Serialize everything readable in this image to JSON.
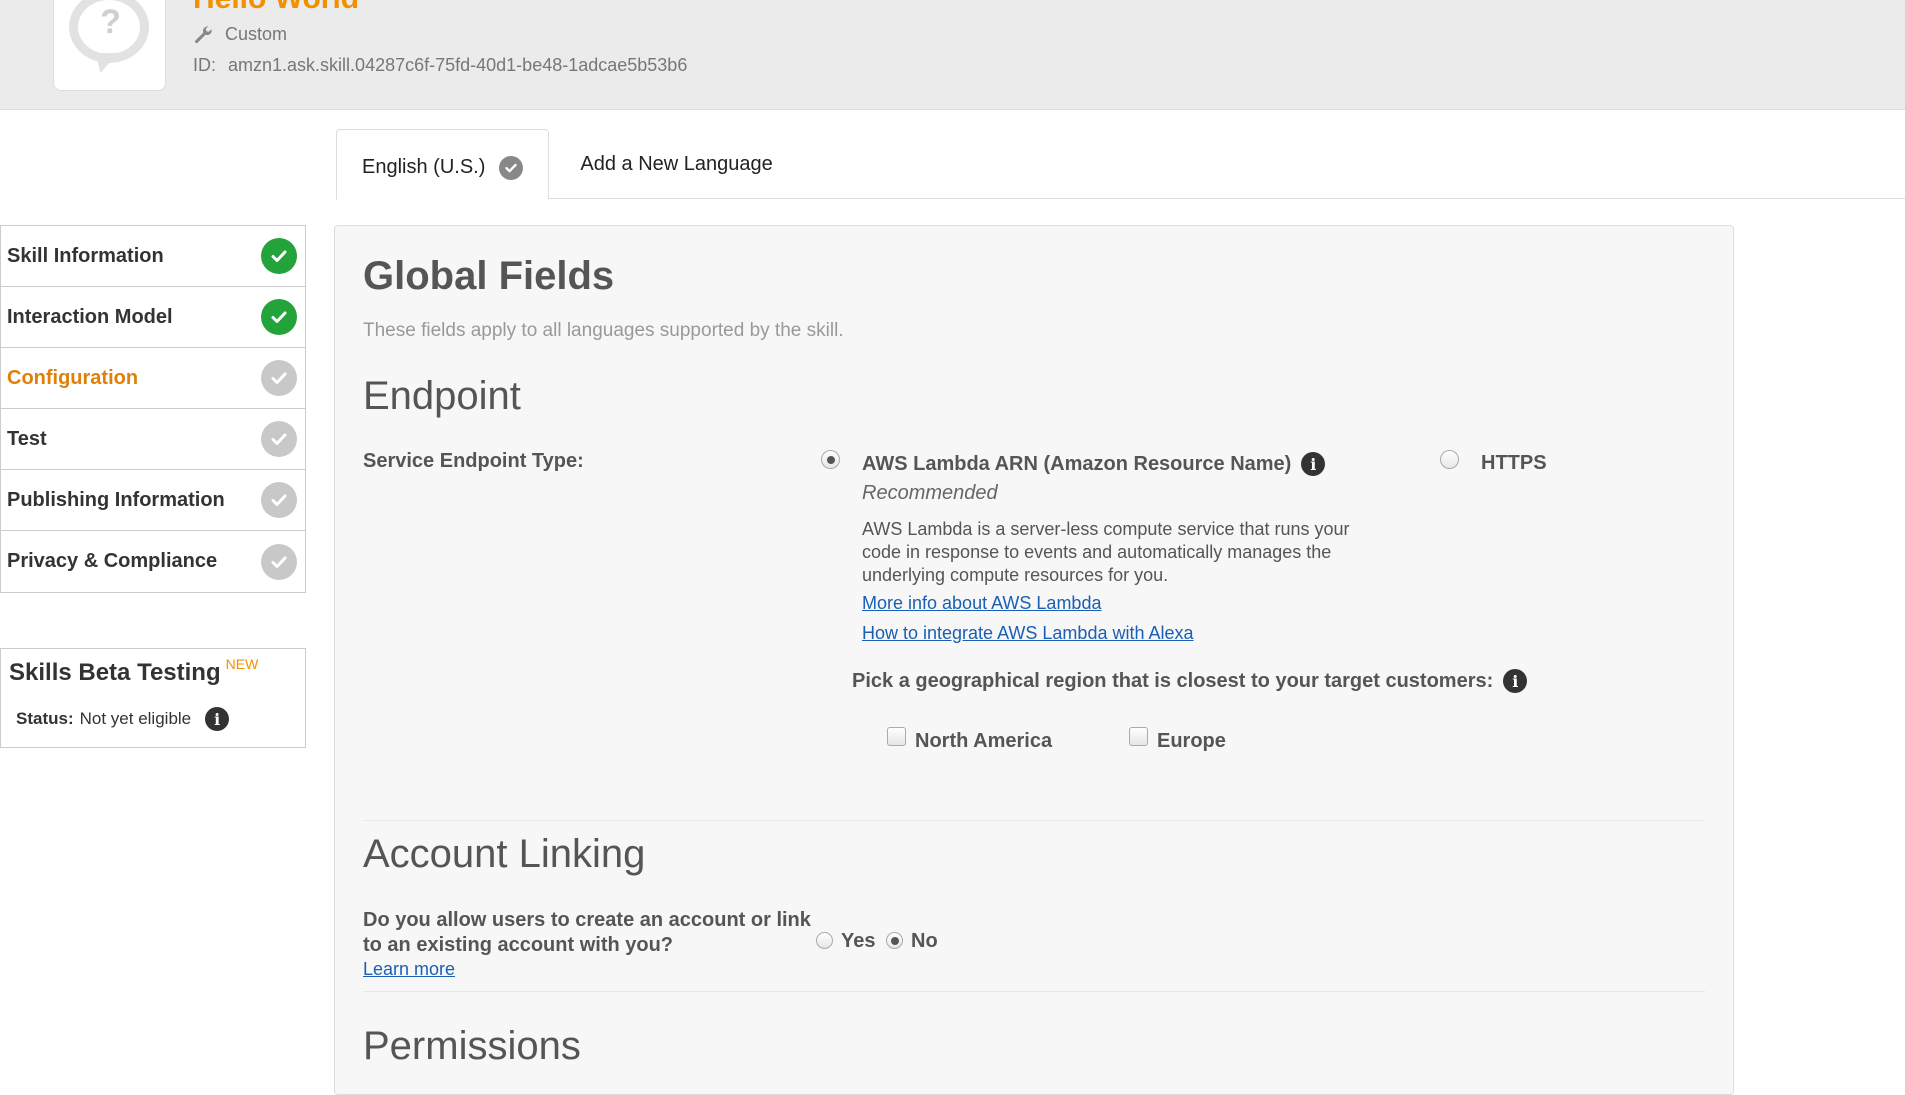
{
  "header": {
    "skill_name": "Hello World",
    "skill_icon_glyph": "?",
    "skill_type": "Custom",
    "id_label": "ID:",
    "id_value": "amzn1.ask.skill.04287c6f-75fd-40d1-be48-1adcae5b53b6"
  },
  "tabs": [
    {
      "label": "English (U.S.)",
      "active": true
    },
    {
      "label": "Add a New Language",
      "active": false
    }
  ],
  "sidebar": {
    "items": [
      {
        "label": "Skill Information",
        "status": "complete"
      },
      {
        "label": "Interaction Model",
        "status": "complete"
      },
      {
        "label": "Configuration",
        "status": "current"
      },
      {
        "label": "Test",
        "status": "incomplete"
      },
      {
        "label": "Publishing Information",
        "status": "incomplete"
      },
      {
        "label": "Privacy & Compliance",
        "status": "incomplete"
      }
    ]
  },
  "beta": {
    "title": "Skills Beta Testing",
    "new_badge": "NEW",
    "status_label": "Status:",
    "status_value": "Not yet eligible"
  },
  "main": {
    "title": "Global Fields",
    "subtitle": "These fields apply to all languages supported by the skill.",
    "endpoint": {
      "heading": "Endpoint",
      "type_label": "Service Endpoint Type:",
      "lambda_label": "AWS Lambda ARN (Amazon Resource Name)",
      "lambda_recommended": "Recommended",
      "lambda_desc": "AWS Lambda is a server-less compute service that runs your code in response to events and automatically manages the underlying compute resources for you.",
      "link_more_info": "More info about AWS Lambda",
      "link_integrate": "How to integrate AWS Lambda with Alexa",
      "https_label": "HTTPS",
      "selected": "AWS Lambda ARN",
      "region_prompt": "Pick a geographical region that is closest to your target customers:",
      "regions": [
        {
          "label": "North America",
          "checked": false
        },
        {
          "label": "Europe",
          "checked": false
        }
      ]
    },
    "account_linking": {
      "heading": "Account Linking",
      "question": "Do you allow users to create an account or link to an existing account with you?",
      "learn_more": "Learn more",
      "options": [
        {
          "label": "Yes",
          "selected": false
        },
        {
          "label": "No",
          "selected": true
        }
      ]
    },
    "permissions": {
      "heading": "Permissions"
    }
  },
  "colors": {
    "accent_orange": "#f29000",
    "complete_green": "#24a33a",
    "incomplete_grey": "#c8c8c8",
    "link_blue": "#1a5fb4"
  }
}
